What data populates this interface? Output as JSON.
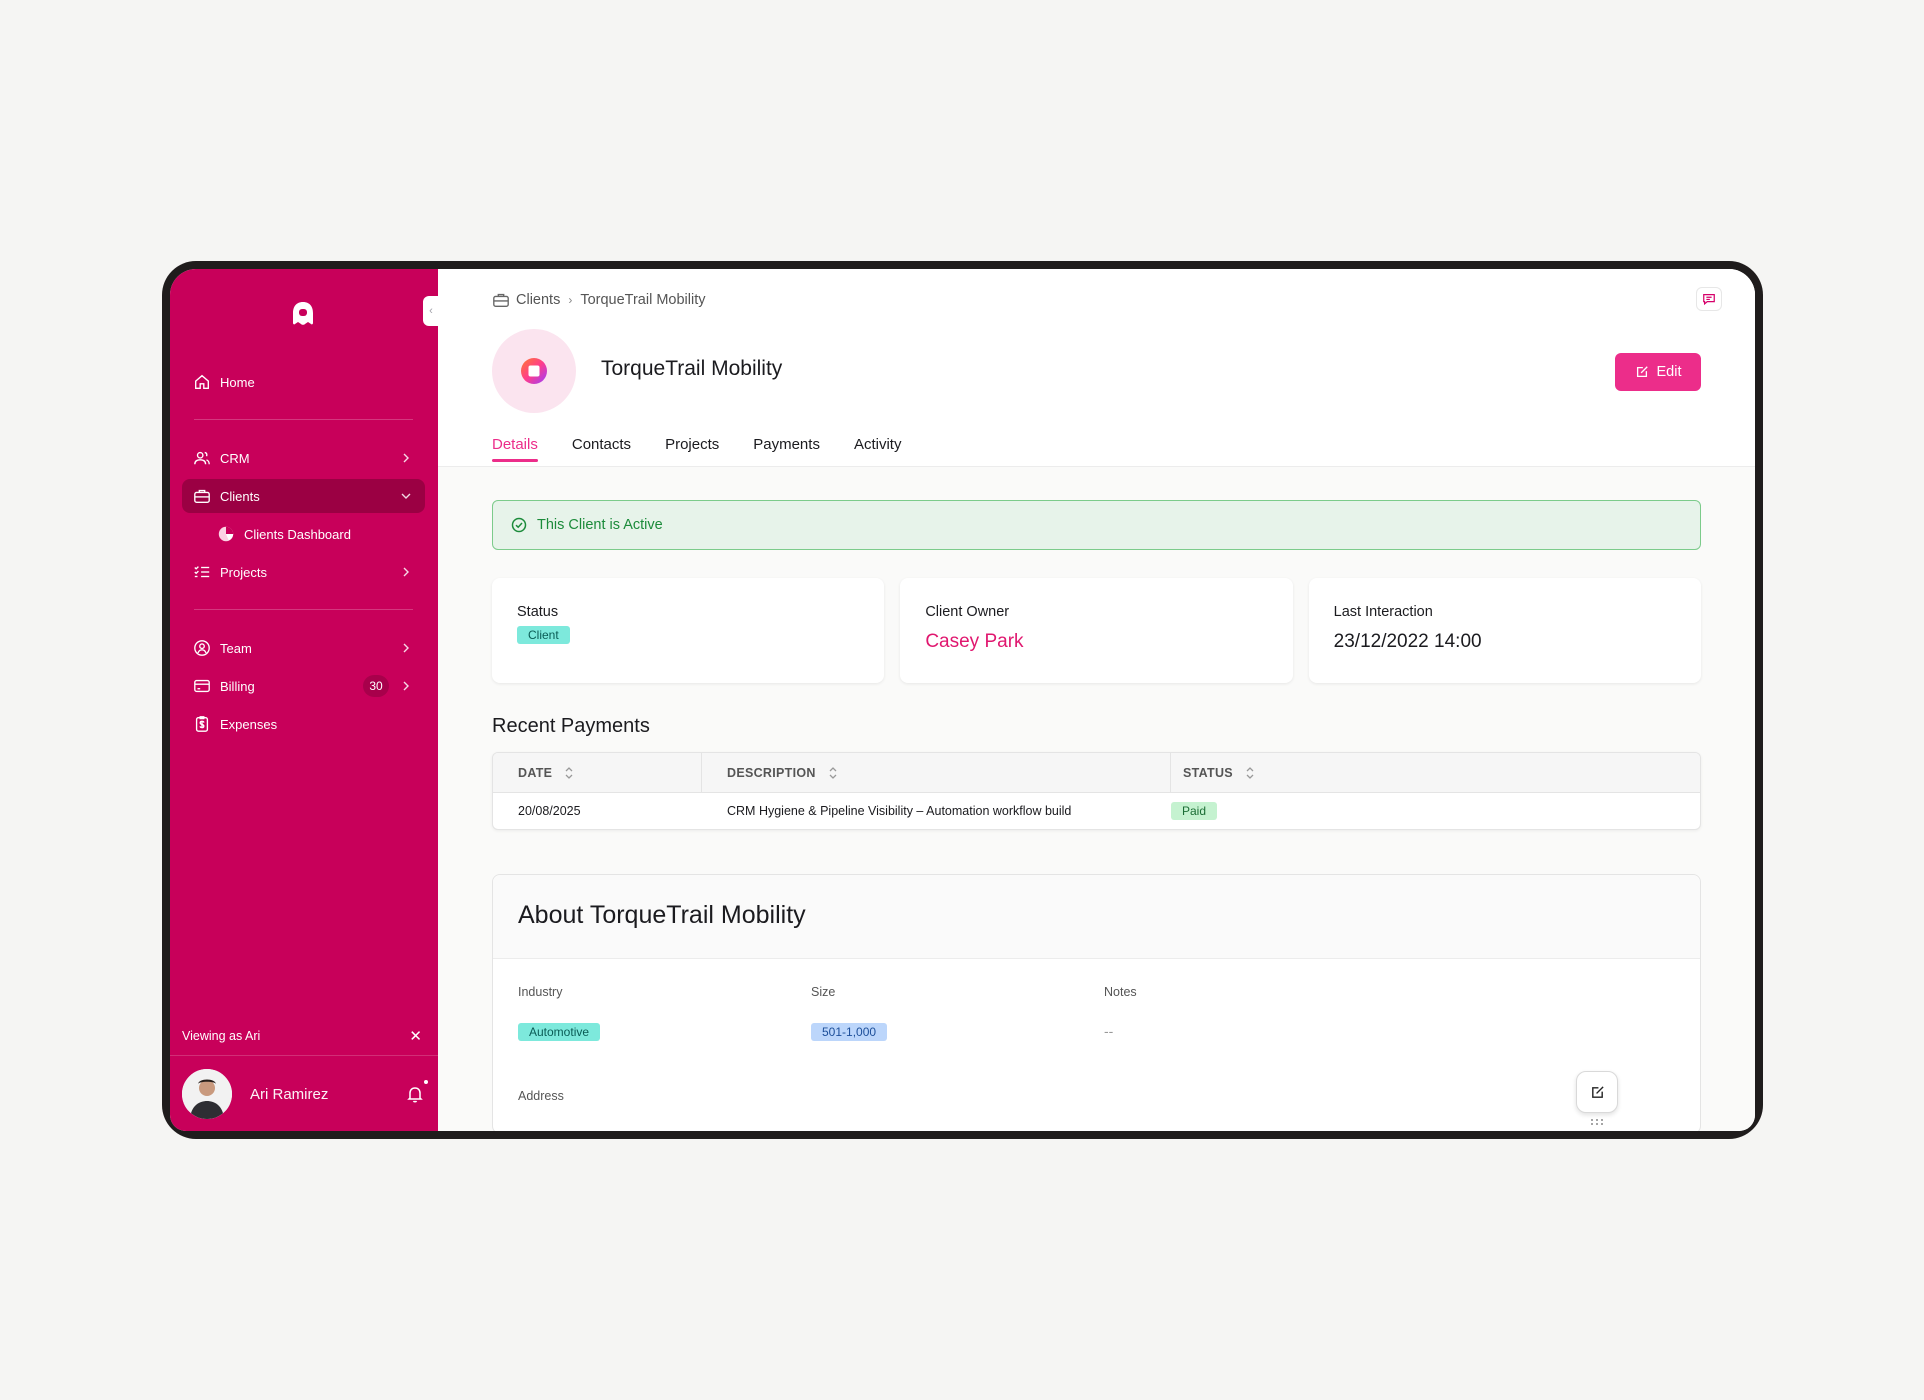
{
  "sidebar": {
    "nav": {
      "home": "Home",
      "crm": "CRM",
      "clients": "Clients",
      "clients_dashboard": "Clients Dashboard",
      "projects": "Projects",
      "team": "Team",
      "billing": "Billing",
      "billing_count": "30",
      "expenses": "Expenses"
    },
    "viewing_as": "Viewing as Ari",
    "user_name": "Ari Ramirez",
    "accent": "#c8005a"
  },
  "breadcrumb": {
    "root": "Clients",
    "current": "TorqueTrail Mobility"
  },
  "client": {
    "name": "TorqueTrail Mobility",
    "edit_label": "Edit"
  },
  "tabs": [
    "Details",
    "Contacts",
    "Projects",
    "Payments",
    "Activity"
  ],
  "alert": "This Client is Active",
  "stats": {
    "status_label": "Status",
    "status_value": "Client",
    "owner_label": "Client Owner",
    "owner_value": "Casey Park",
    "last_label": "Last Interaction",
    "last_value": "23/12/2022 14:00"
  },
  "payments": {
    "title": "Recent Payments",
    "columns": [
      "DATE",
      "DESCRIPTION",
      "STATUS"
    ],
    "rows": [
      {
        "date": "20/08/2025",
        "description": "CRM Hygiene & Pipeline Visibility – Automation workflow build",
        "status": "Paid"
      }
    ]
  },
  "about": {
    "title": "About TorqueTrail Mobility",
    "industry_label": "Industry",
    "industry_value": "Automotive",
    "size_label": "Size",
    "size_value": "501-1,000",
    "notes_label": "Notes",
    "notes_value": "--",
    "address_label": "Address"
  },
  "colors": {
    "brand_pink": "#ec2d8a",
    "sidebar_bg": "#c8005a",
    "success_green": "#1c8b3b"
  }
}
